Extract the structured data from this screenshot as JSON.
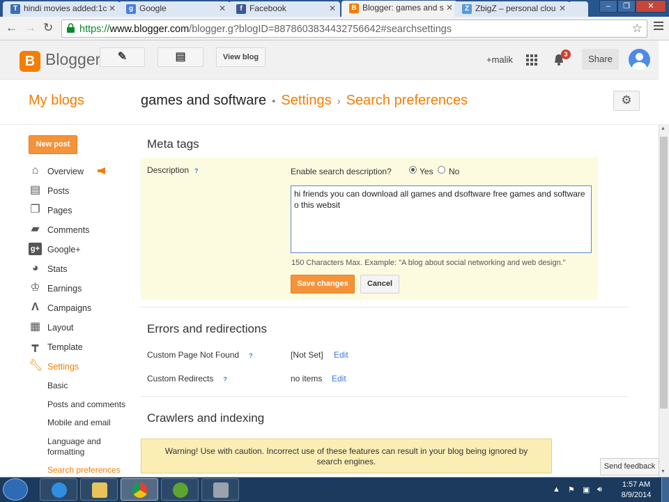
{
  "browser": {
    "tabs": [
      {
        "title": "hindi movies added:1c",
        "favicon": "T",
        "color": "#3b6fb5"
      },
      {
        "title": "Google",
        "favicon": "g",
        "color": "#4a7fe0"
      },
      {
        "title": "Facebook",
        "favicon": "f",
        "color": "#3b5998"
      },
      {
        "title": "Blogger: games and s",
        "favicon": "B",
        "color": "#f57d00"
      },
      {
        "title": "ZbigZ – personal clou",
        "favicon": "Z",
        "color": "#5a9bd5"
      }
    ],
    "url_scheme": "https://",
    "url_host": "www.blogger.com",
    "url_path": "/blogger.g?blogID=8878603834432756642#searchsettings"
  },
  "header": {
    "brand": "Blogger",
    "view_blog": "View blog",
    "user": "+malik",
    "notifications": "3",
    "share": "Share"
  },
  "breadcrumb": {
    "my_blogs": "My blogs",
    "blog": "games and software",
    "section": "Settings",
    "page": "Search preferences"
  },
  "sidebar": {
    "new_post": "New post",
    "items": [
      {
        "label": "Overview",
        "icon": "home-icon"
      },
      {
        "label": "Posts",
        "icon": "posts-icon"
      },
      {
        "label": "Pages",
        "icon": "pages-icon"
      },
      {
        "label": "Comments",
        "icon": "comments-icon"
      },
      {
        "label": "Google+",
        "icon": "google-plus-icon"
      },
      {
        "label": "Stats",
        "icon": "stats-icon"
      },
      {
        "label": "Earnings",
        "icon": "trophy-icon"
      },
      {
        "label": "Campaigns",
        "icon": "adwords-icon"
      },
      {
        "label": "Layout",
        "icon": "layout-icon"
      },
      {
        "label": "Template",
        "icon": "template-icon"
      },
      {
        "label": "Settings",
        "icon": "wrench-icon"
      }
    ],
    "settings_sub": [
      "Basic",
      "Posts and comments",
      "Mobile and email",
      "Language and formatting",
      "Search preferences"
    ]
  },
  "meta_tags": {
    "title": "Meta tags",
    "description_label": "Description",
    "help": "?",
    "enable_question": "Enable search description?",
    "yes": "Yes",
    "no": "No",
    "selected": "Yes",
    "textarea_value": "hi friends you can download all games and dsoftware free games and software o this websit",
    "hint": "150 Characters Max. Example: \"A blog about social networking and web design.\"",
    "save": "Save changes",
    "cancel": "Cancel"
  },
  "errors": {
    "title": "Errors and redirections",
    "not_found_label": "Custom Page Not Found",
    "not_found_value": "[Not Set]",
    "redirects_label": "Custom Redirects",
    "redirects_value": "no items",
    "edit": "Edit"
  },
  "crawlers": {
    "title": "Crawlers and indexing",
    "warning": "Warning! Use with caution. Incorrect use of these features can result in your blog being ignored by search engines."
  },
  "feedback": "Send feedback",
  "taskbar": {
    "time": "1:57 AM",
    "date": "8/9/2014"
  },
  "colors": {
    "accent": "#f57d00",
    "link": "#3c78d8",
    "meta_bg": "#fcfbe0",
    "warning_bg": "#fbeeb4"
  }
}
